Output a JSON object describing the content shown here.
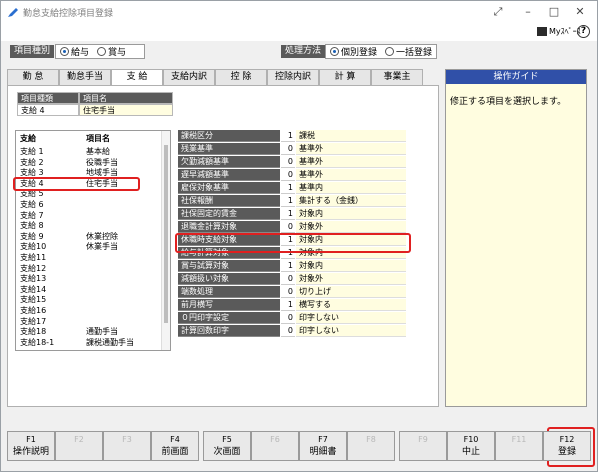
{
  "window": {
    "title": "勤怠支給控除項目登録"
  },
  "toolbar": {
    "my_label": "Myｽﾍﾟｰｽ",
    "help_label": "?"
  },
  "controls": {
    "item_type_label": "項目種別",
    "item_type_options": [
      "給与",
      "賞与"
    ],
    "method_label": "処理方法",
    "method_options": [
      "個別登録",
      "一括登録"
    ]
  },
  "tabs": [
    "勤 怠",
    "勤怠手当",
    "支 給",
    "支給内訳",
    "控 除",
    "控除内訳",
    "計 算",
    "事業主"
  ],
  "guide": {
    "title": "操作ガイド",
    "text": "修正する項目を選択します。"
  },
  "current": {
    "col1_header": "項目種類",
    "col2_header": "項目名",
    "type": "支給 4",
    "name": "住宅手当"
  },
  "list": {
    "col1_header": "支給",
    "col2_header": "項目名",
    "rows": [
      [
        "支給 1",
        "基本給"
      ],
      [
        "支給 2",
        "役職手当"
      ],
      [
        "支給 3",
        "地域手当"
      ],
      [
        "支給 4",
        "住宅手当"
      ],
      [
        "支給 5",
        ""
      ],
      [
        "支給 6",
        ""
      ],
      [
        "支給 7",
        ""
      ],
      [
        "支給 8",
        ""
      ],
      [
        "支給 9",
        "休業控除"
      ],
      [
        "支給10",
        "休業手当"
      ],
      [
        "支給11",
        ""
      ],
      [
        "支給12",
        ""
      ],
      [
        "支給13",
        ""
      ],
      [
        "支給14",
        ""
      ],
      [
        "支給15",
        ""
      ],
      [
        "支給16",
        ""
      ],
      [
        "支給17",
        ""
      ],
      [
        "支給18",
        "通勤手当"
      ],
      [
        "支給18-1",
        "課税通勤手当"
      ]
    ]
  },
  "properties": [
    [
      "課税区分",
      "1",
      "課税"
    ],
    [
      "残業基準",
      "0",
      "基準外"
    ],
    [
      "欠勤減額基準",
      "0",
      "基準外"
    ],
    [
      "遅早減額基準",
      "0",
      "基準外"
    ],
    [
      "雇保対象基準",
      "1",
      "基準内"
    ],
    [
      "社保報酬",
      "1",
      "集計する（金銭）"
    ],
    [
      "社保固定的賃金",
      "1",
      "対象内"
    ],
    [
      "退職金計算対象",
      "0",
      "対象外"
    ],
    [
      "休職時支給対象",
      "1",
      "対象内"
    ],
    [
      "給与計算対象",
      "1",
      "対象内"
    ],
    [
      "賞与試算対象",
      "1",
      "対象内"
    ],
    [
      "減額扱い対象",
      "0",
      "対象外"
    ],
    [
      "端数処理",
      "0",
      "切り上げ"
    ],
    [
      "前月横写",
      "1",
      "横写する"
    ],
    [
      "０円印字設定",
      "0",
      "印字しない"
    ],
    [
      "計算回数印字",
      "0",
      "印字しない"
    ]
  ],
  "fkeys": [
    {
      "key": "F1",
      "label": "操作説明",
      "enabled": true
    },
    {
      "key": "F2",
      "label": "",
      "enabled": false
    },
    {
      "key": "F3",
      "label": "",
      "enabled": false
    },
    {
      "key": "F4",
      "label": "前画面",
      "enabled": true
    },
    {
      "key": "F5",
      "label": "次画面",
      "enabled": true
    },
    {
      "key": "F6",
      "label": "",
      "enabled": false
    },
    {
      "key": "F7",
      "label": "明細書",
      "enabled": true
    },
    {
      "key": "F8",
      "label": "",
      "enabled": false
    },
    {
      "key": "F9",
      "label": "",
      "enabled": false
    },
    {
      "key": "F10",
      "label": "中止",
      "enabled": true
    },
    {
      "key": "F11",
      "label": "",
      "enabled": false
    },
    {
      "key": "F12",
      "label": "登録",
      "enabled": true
    }
  ],
  "colors": {
    "accent": "#3050a8",
    "highlight": "#e02020",
    "header_bg": "#5a5a5a",
    "value_bg": "#fffde0"
  }
}
